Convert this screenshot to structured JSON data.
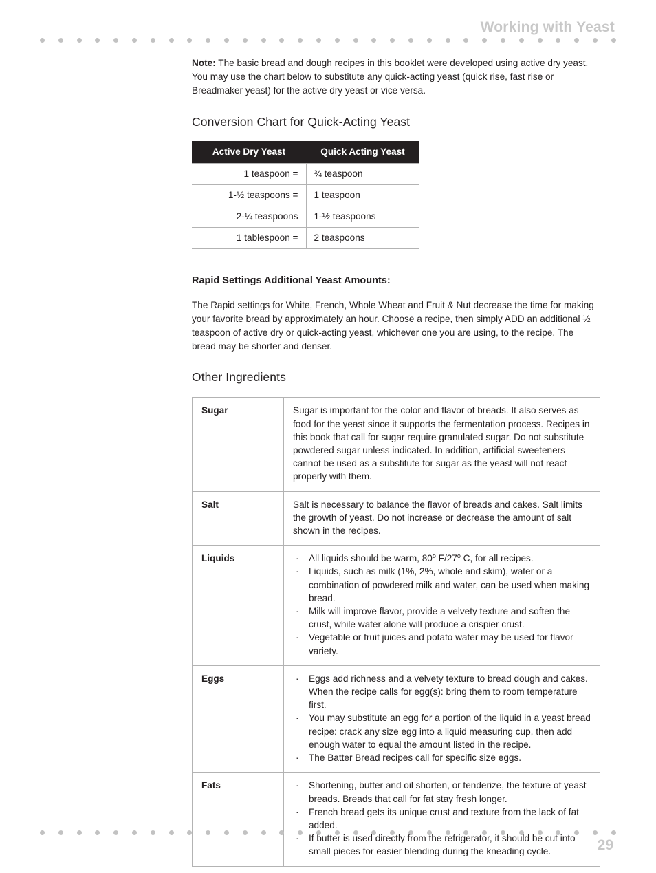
{
  "header": {
    "title": "Working with Yeast"
  },
  "footer": {
    "page_number": "29",
    "dot_count": 32,
    "dot_color": "#c2c2c2"
  },
  "colors": {
    "text": "#231f20",
    "muted": "#c8c8c8",
    "table_border": "#b3b3b3",
    "table_header_bg": "#231f20",
    "table_header_text": "#ffffff"
  },
  "note": {
    "label": "Note:",
    "text": " The basic bread and dough recipes in this booklet were developed using active dry yeast. You may use the chart below to substitute any quick-acting yeast (quick rise, fast rise or Breadmaker yeast) for the active dry yeast or vice versa."
  },
  "conversion": {
    "heading": "Conversion Chart for Quick-Acting Yeast",
    "columns": [
      "Active Dry Yeast",
      "Quick Acting Yeast"
    ],
    "rows": [
      {
        "active_dry": "1 teaspoon =",
        "quick_acting": "¾ teaspoon"
      },
      {
        "active_dry": "1-½ teaspoons =",
        "quick_acting": "1 teaspoon"
      },
      {
        "active_dry": "2-¼ teaspoons",
        "quick_acting": "1-½ teaspoons"
      },
      {
        "active_dry": "1 tablespoon =",
        "quick_acting": "2 teaspoons"
      }
    ]
  },
  "rapid": {
    "heading": "Rapid Settings Additional Yeast Amounts:",
    "text": "The Rapid settings for White, French, Whole Wheat and Fruit & Nut decrease the time for making your favorite bread by approximately an hour. Choose a recipe, then simply ADD an additional ½ teaspoon of active dry or quick-acting yeast, whichever one you are using, to the recipe. The bread may be shorter and denser."
  },
  "other_ingredients": {
    "heading": "Other Ingredients",
    "rows": [
      {
        "name": "Sugar",
        "type": "paragraph",
        "text": "Sugar is important for the color and flavor of breads. It also serves as food for the yeast since it supports the fermentation process. Recipes in this book that call for sugar require granulated sugar. Do not substitute powdered sugar unless indicated. In addition, artificial sweeteners cannot be used as a substitute for sugar as the yeast will not react properly with them."
      },
      {
        "name": "Salt",
        "type": "paragraph",
        "text": "Salt is necessary to balance the flavor of breads and cakes. Salt limits the growth of yeast. Do not increase or decrease the amount of salt shown in the recipes."
      },
      {
        "name": "Liquids",
        "type": "bullets",
        "bullets": [
          "All liquids should be warm, 80º F/27º C, for all recipes.",
          "Liquids, such as milk (1%, 2%, whole and skim), water or a combination of powdered milk and water, can be used when making bread.",
          "Milk will improve flavor, provide a velvety texture and soften the crust, while water alone will produce a crispier crust.",
          "Vegetable or fruit juices and potato water may be used for flavor variety."
        ]
      },
      {
        "name": "Eggs",
        "type": "bullets",
        "bullets": [
          "Eggs add richness and a velvety texture to bread dough and cakes. When the recipe calls for egg(s): bring them to room temperature first.",
          "You may substitute an egg for a portion of the liquid in a yeast bread recipe: crack any size egg into a liquid measuring cup, then add enough water to equal the amount listed in the recipe.",
          "The Batter Bread recipes call for specific size eggs."
        ]
      },
      {
        "name": "Fats",
        "type": "bullets",
        "bullets": [
          "Shortening, butter and oil shorten, or tenderize, the texture of yeast breads. Breads that call for fat stay fresh longer.",
          "French bread gets its unique crust and texture from the lack of fat added.",
          "If butter is used directly from the refrigerator, it should be cut into small pieces for easier blending during the kneading cycle."
        ]
      }
    ]
  },
  "icons": {
    "bullet": "·",
    "decorative_dot": "dot-icon"
  }
}
